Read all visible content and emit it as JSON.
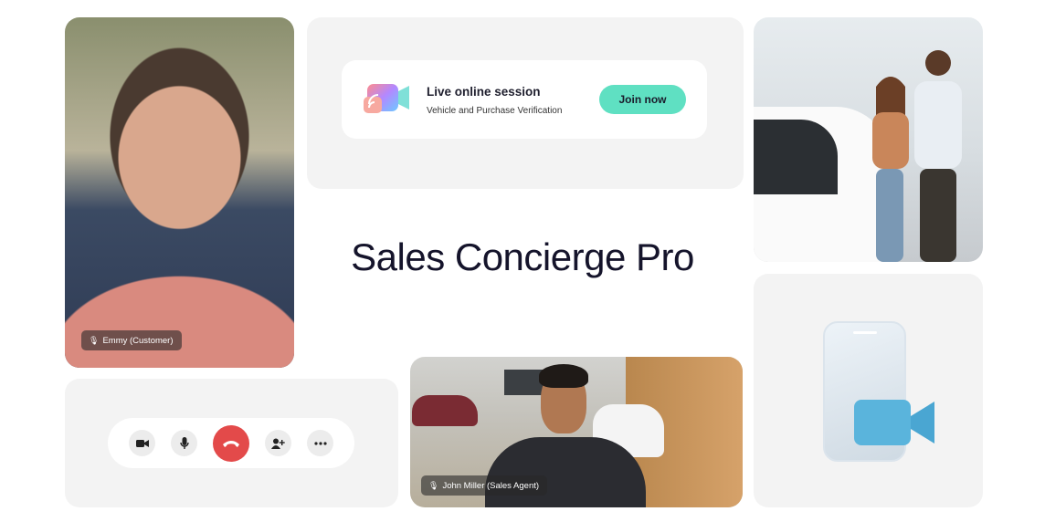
{
  "customer_video": {
    "name_label": "Emmy (Customer)"
  },
  "session": {
    "title": "Live online session",
    "subtitle": "Vehicle and Purchase Verification",
    "join_label": "Join now"
  },
  "app_title": "Sales Concierge Pro",
  "agent_video": {
    "name_label": "John Miller (Sales Agent)"
  },
  "controls": [
    {
      "name": "camera",
      "icon": "video-camera-icon"
    },
    {
      "name": "mic",
      "icon": "microphone-icon"
    },
    {
      "name": "end-call",
      "icon": "phone-hangup-icon",
      "color": "#e34a4a"
    },
    {
      "name": "add-participant",
      "icon": "add-user-icon"
    },
    {
      "name": "more",
      "icon": "more-options-icon"
    }
  ],
  "colors": {
    "accent": "#5fe0c2",
    "end_call": "#e34a4a",
    "title": "#15142b"
  }
}
